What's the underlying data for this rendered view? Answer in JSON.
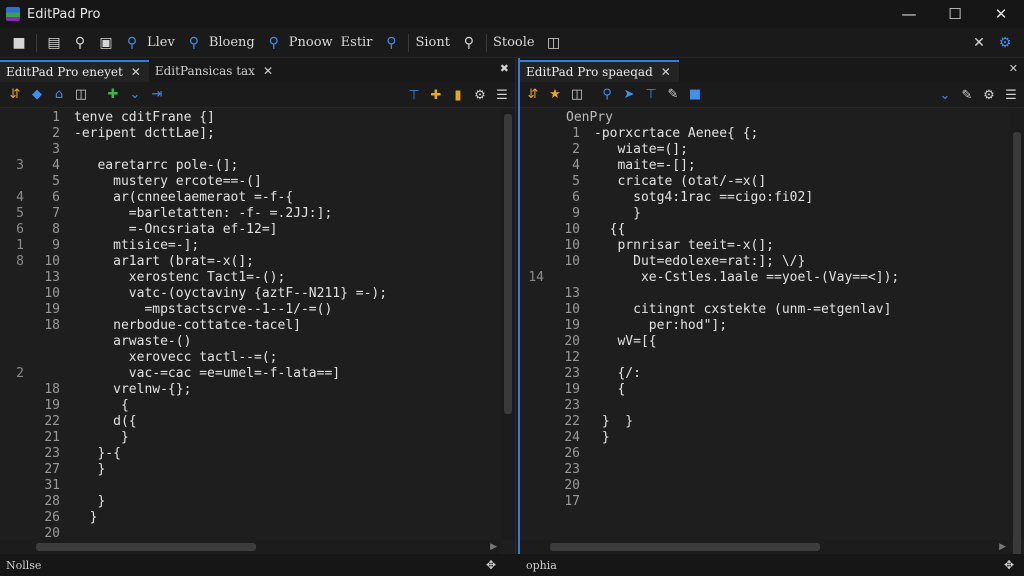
{
  "app": {
    "title": "EditPad Pro"
  },
  "window_controls": {
    "minimize": "—",
    "maximize": "☐",
    "close": "✕"
  },
  "toolbar": {
    "labels": [
      "Llev",
      "Bloeng",
      "Pnoow",
      "Estir",
      "Siont",
      "Stoole"
    ],
    "close_label": "✕"
  },
  "left_pane": {
    "tab": {
      "label": "EditPad Pro eneyet",
      "close": "✕"
    },
    "tab2": {
      "label": "EditPansicas tax",
      "close": "✕"
    },
    "close_all": "✖",
    "lines": [
      {
        "ln": "1",
        "outer": "",
        "code": "tenve cditFrane {]"
      },
      {
        "ln": "2",
        "outer": "",
        "code": "-eripent dcttLae];"
      },
      {
        "ln": "3",
        "outer": "",
        "code": ""
      },
      {
        "ln": "4",
        "outer": "3",
        "code": "   earetarrc pole-(];"
      },
      {
        "ln": "5",
        "outer": "",
        "code": "     mustery ercote==-(]"
      },
      {
        "ln": "6",
        "outer": "4",
        "code": "     ar(cnneelaemeraot =-f-{"
      },
      {
        "ln": "7",
        "outer": "5",
        "code": "       =barletatten: -f- =.2JJ:];"
      },
      {
        "ln": "8",
        "outer": "6",
        "code": "       =-Oncsriata ef-12=]"
      },
      {
        "ln": "9",
        "outer": "1",
        "code": "     mtisice=-];"
      },
      {
        "ln": "10",
        "outer": "8",
        "code": "     ar1art (brat=-x(];"
      },
      {
        "ln": "13",
        "outer": "",
        "code": "       xerostenc Tact1=-();"
      },
      {
        "ln": "10",
        "outer": "",
        "code": "       vatc-(oyctaviny {aztF--N211} =-);"
      },
      {
        "ln": "19",
        "outer": "",
        "code": "         =mpstactscrve--1--1/-=()"
      },
      {
        "ln": "18",
        "outer": "",
        "code": "     nerbodue-cottatce-tacel]"
      },
      {
        "ln": "",
        "outer": "",
        "code": "     arwaste-()"
      },
      {
        "ln": "",
        "outer": "",
        "code": "       xerovecc tactl--=(;"
      },
      {
        "ln": "",
        "outer": "2",
        "code": "       vac-=cac =e=umel=-f-lata==]"
      },
      {
        "ln": "18",
        "outer": "",
        "code": "     vrelnw-{};"
      },
      {
        "ln": "19",
        "outer": "",
        "code": "      {"
      },
      {
        "ln": "22",
        "outer": "",
        "code": "     d({"
      },
      {
        "ln": "21",
        "outer": "",
        "code": "      }"
      },
      {
        "ln": "23",
        "outer": "",
        "code": "   }-{"
      },
      {
        "ln": "27",
        "outer": "",
        "code": "   }"
      },
      {
        "ln": "31",
        "outer": "",
        "code": ""
      },
      {
        "ln": "28",
        "outer": "",
        "code": "   }"
      },
      {
        "ln": "26",
        "outer": "",
        "code": "  }"
      },
      {
        "ln": "20",
        "outer": "",
        "code": ""
      }
    ]
  },
  "right_pane": {
    "tab": {
      "label": "EditPad Pro spaeqad",
      "close": "✕"
    },
    "close_all": "✕",
    "header_label": "OenPry",
    "lines": [
      {
        "ln": "1",
        "outer": "",
        "code": "-porxcrtace Aenee{ {;"
      },
      {
        "ln": "2",
        "outer": "",
        "code": "   wiate=(];"
      },
      {
        "ln": "4",
        "outer": "",
        "code": "   maite=-[];"
      },
      {
        "ln": "5",
        "outer": "",
        "code": "   cricate (otat/-=x(]"
      },
      {
        "ln": "6",
        "outer": "",
        "code": "     sotg4:1rac ==cigo:fi02]"
      },
      {
        "ln": "9",
        "outer": "",
        "code": "     }"
      },
      {
        "ln": "10",
        "outer": "",
        "code": "  {{"
      },
      {
        "ln": "10",
        "outer": "",
        "code": "   prnrisar teeit=-x(];"
      },
      {
        "ln": "10",
        "outer": "",
        "code": "     Dut=edolexe=rat:]; \\/}"
      },
      {
        "ln": "",
        "outer": "14",
        "code": "      xe-Cstles.1aale ==yoel-(Vay==<]);"
      },
      {
        "ln": "13",
        "outer": "",
        "code": ""
      },
      {
        "ln": "10",
        "outer": "",
        "code": "     citingnt cxstekte (unm-=etgenlav]"
      },
      {
        "ln": "19",
        "outer": "",
        "code": "       per:hod\"];"
      },
      {
        "ln": "20",
        "outer": "",
        "code": "   wV=[{"
      },
      {
        "ln": "12",
        "outer": "",
        "code": ""
      },
      {
        "ln": "23",
        "outer": "",
        "code": "   {/:"
      },
      {
        "ln": "19",
        "outer": "",
        "code": "   {"
      },
      {
        "ln": "23",
        "outer": "",
        "code": ""
      },
      {
        "ln": "22",
        "outer": "",
        "code": " }  }"
      },
      {
        "ln": "24",
        "outer": "",
        "code": " }"
      },
      {
        "ln": "26",
        "outer": "",
        "code": ""
      },
      {
        "ln": "23",
        "outer": "",
        "code": ""
      },
      {
        "ln": "20",
        "outer": "",
        "code": ""
      },
      {
        "ln": "17",
        "outer": "",
        "code": ""
      }
    ]
  },
  "status": {
    "left": "Nollse",
    "right": "ophia",
    "grip": "✥"
  },
  "colors": {
    "accent": "#2f7ed8",
    "background": "#1e1e1e"
  }
}
